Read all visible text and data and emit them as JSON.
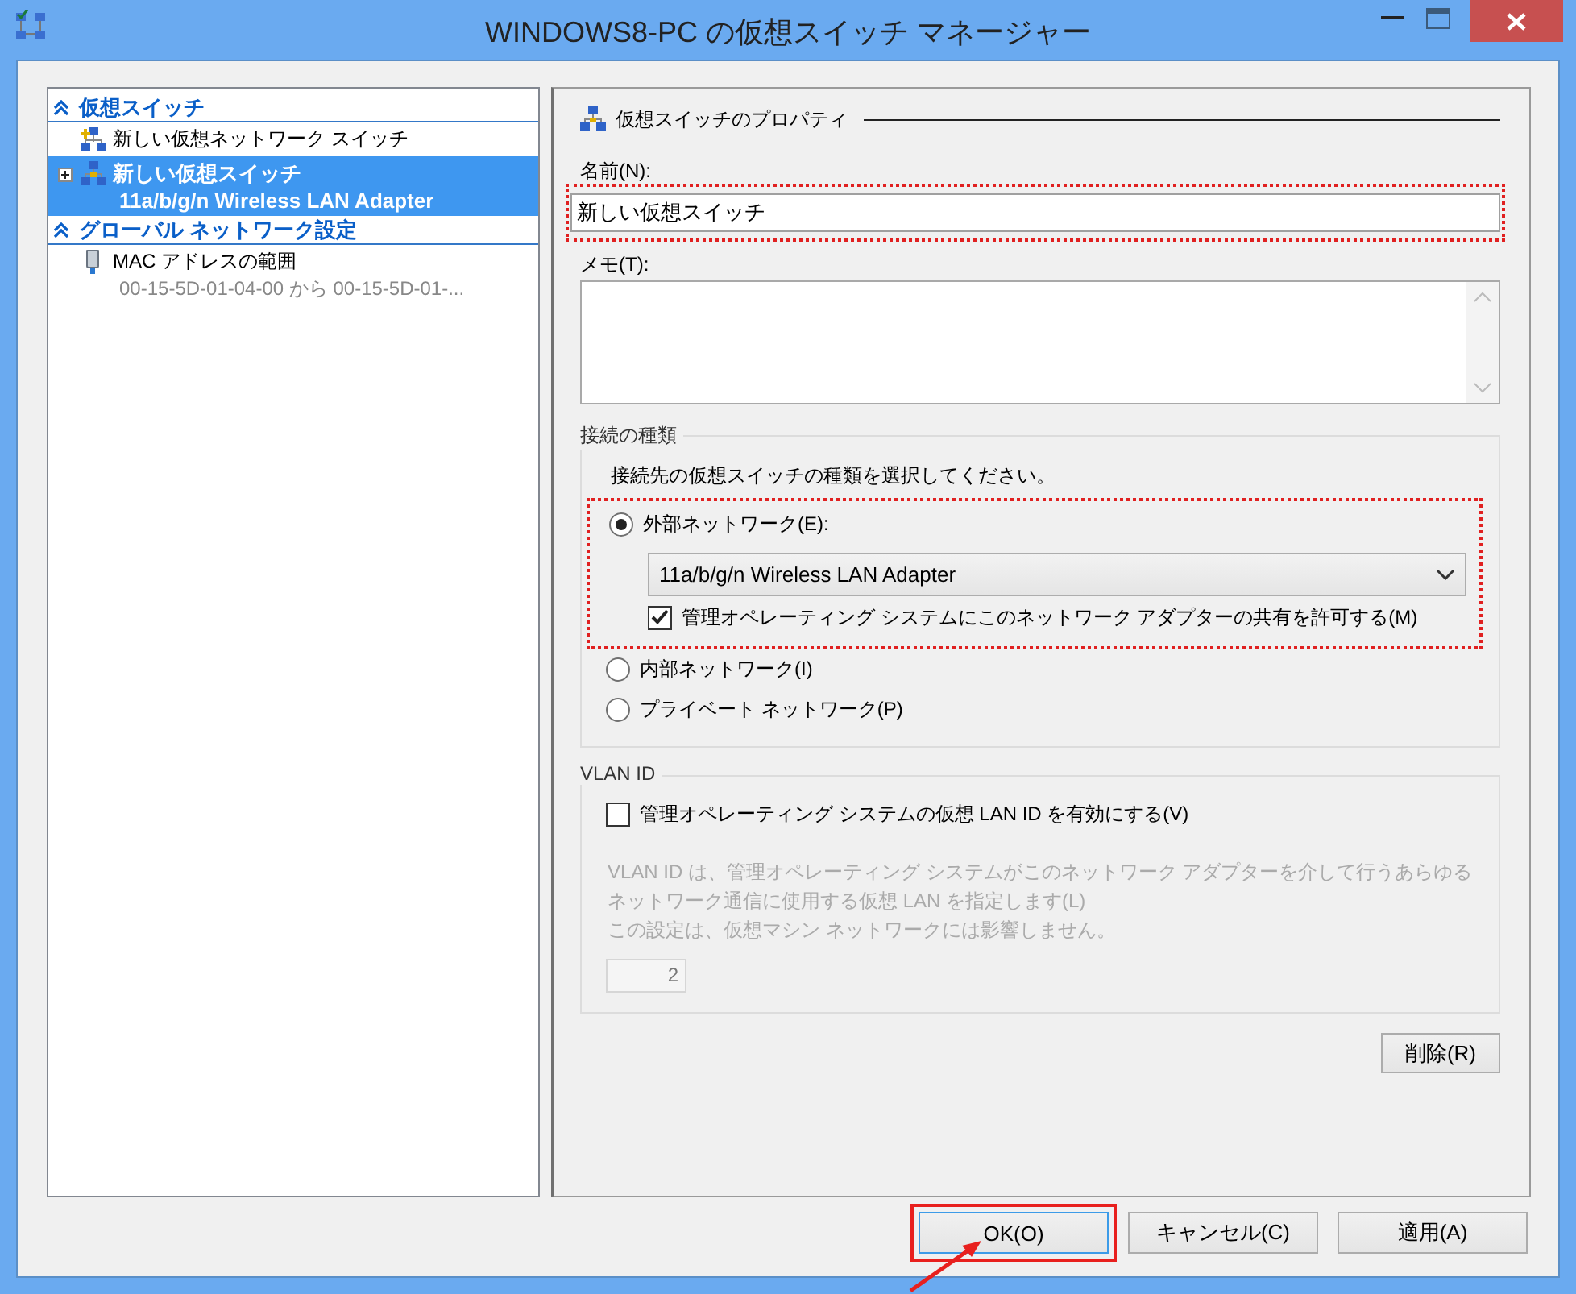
{
  "window": {
    "title": "WINDOWS8-PC の仮想スイッチ マネージャー"
  },
  "tree": {
    "sections": [
      {
        "title": "仮想スイッチ",
        "expanded": true,
        "items": [
          {
            "kind": "new",
            "label": "新しい仮想ネットワーク スイッチ",
            "selected": false
          },
          {
            "kind": "switch",
            "label": "新しい仮想スイッチ",
            "detail": "11a/b/g/n Wireless LAN Adapter",
            "selected": true,
            "expanded": false
          }
        ]
      },
      {
        "title": "グローバル ネットワーク設定",
        "expanded": true,
        "items": [
          {
            "kind": "mac",
            "label": "MAC アドレスの範囲",
            "detail": "00-15-5D-01-04-00 から 00-15-5D-01-...",
            "selected": false
          }
        ]
      }
    ]
  },
  "properties": {
    "heading": "仮想スイッチのプロパティ",
    "name_label": "名前(N):",
    "name_value": "新しい仮想スイッチ",
    "name_highlighted": true,
    "memo_label": "メモ(T):",
    "connection": {
      "legend": "接続の種類",
      "instruction": "接続先の仮想スイッチの種類を選択してください。",
      "external_highlighted": true,
      "options": [
        {
          "label": "外部ネットワーク(E):",
          "selected": true
        },
        {
          "label": "内部ネットワーク(I)",
          "selected": false
        },
        {
          "label": "プライベート ネットワーク(P)",
          "selected": false
        }
      ],
      "adapter": "11a/b/g/n Wireless LAN Adapter",
      "share_label": "管理オペレーティング システムにこのネットワーク アダプターの共有を許可する(M)",
      "share_checked": true
    },
    "vlan": {
      "legend": "VLAN ID",
      "enable_label": "管理オペレーティング システムの仮想 LAN ID を有効にする(V)",
      "enabled": false,
      "description": [
        "VLAN ID は、管理オペレーティング システムがこのネットワーク アダプターを介して行うあらゆるネットワーク通信に使用する仮想 LAN を指定します(L)",
        "この設定は、仮想マシン ネットワークには影響しません。"
      ],
      "vlan_id": "2"
    },
    "delete_button": "削除(R)"
  },
  "buttons": [
    {
      "label": "OK(O)",
      "focused": true,
      "highlighted": true
    },
    {
      "label": "キャンセル(C)",
      "focused": false,
      "highlighted": false
    },
    {
      "label": "適用(A)",
      "focused": false,
      "highlighted": false
    }
  ]
}
